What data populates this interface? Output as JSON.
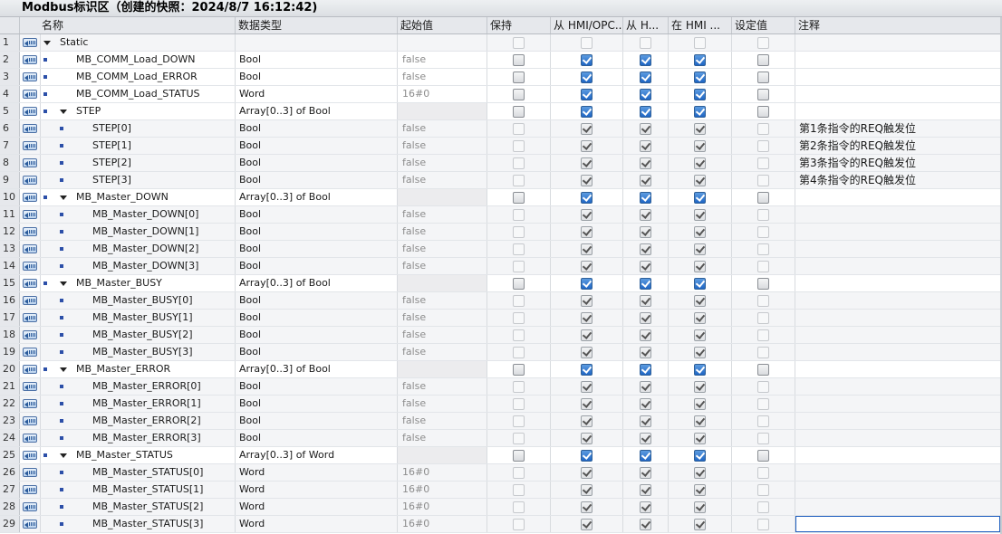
{
  "title": "Modbus标识区（创建的快照：2024/8/7 16:12:42)",
  "columns": {
    "name": "名称",
    "datatype": "数据类型",
    "start": "起始值",
    "retain": "保持",
    "hmi_access": "从 HMI/OPC..",
    "hmi_write": "从 H...",
    "hmi_visible": "在 HMI ...",
    "setpoint": "设定值",
    "comment": "注释"
  },
  "rows": [
    {
      "num": "1",
      "level": 0,
      "marker": "arrow",
      "name": "Static",
      "datatype": "",
      "start": "",
      "flags": [],
      "comment": ""
    },
    {
      "num": "2",
      "level": 1,
      "marker": "none",
      "name": "MB_COMM_Load_DOWN",
      "datatype": "Bool",
      "start": "false",
      "flags": [
        "u",
        "c",
        "c",
        "c",
        "u"
      ],
      "comment": ""
    },
    {
      "num": "3",
      "level": 1,
      "marker": "none",
      "name": "MB_COMM_Load_ERROR",
      "datatype": "Bool",
      "start": "false",
      "flags": [
        "u",
        "c",
        "c",
        "c",
        "u"
      ],
      "comment": ""
    },
    {
      "num": "4",
      "level": 1,
      "marker": "none",
      "name": "MB_COMM_Load_STATUS",
      "datatype": "Word",
      "start": "16#0",
      "flags": [
        "u",
        "c",
        "c",
        "c",
        "u"
      ],
      "comment": ""
    },
    {
      "num": "5",
      "level": 1,
      "marker": "arrow",
      "name": "STEP",
      "datatype": "Array[0..3] of Bool",
      "start": "",
      "flags": [
        "u",
        "c",
        "c",
        "c",
        "u"
      ],
      "comment": ""
    },
    {
      "num": "6",
      "level": 2,
      "marker": "none",
      "name": "STEP[0]",
      "datatype": "Bool",
      "start": "false",
      "flags": [
        "d",
        "g",
        "g",
        "g",
        "d"
      ],
      "comment": "第1条指令的REQ触发位"
    },
    {
      "num": "7",
      "level": 2,
      "marker": "none",
      "name": "STEP[1]",
      "datatype": "Bool",
      "start": "false",
      "flags": [
        "d",
        "g",
        "g",
        "g",
        "d"
      ],
      "comment": "第2条指令的REQ触发位"
    },
    {
      "num": "8",
      "level": 2,
      "marker": "none",
      "name": "STEP[2]",
      "datatype": "Bool",
      "start": "false",
      "flags": [
        "d",
        "g",
        "g",
        "g",
        "d"
      ],
      "comment": "第3条指令的REQ触发位"
    },
    {
      "num": "9",
      "level": 2,
      "marker": "none",
      "name": "STEP[3]",
      "datatype": "Bool",
      "start": "false",
      "flags": [
        "d",
        "g",
        "g",
        "g",
        "d"
      ],
      "comment": "第4条指令的REQ触发位"
    },
    {
      "num": "10",
      "level": 1,
      "marker": "arrow",
      "name": "MB_Master_DOWN",
      "datatype": "Array[0..3] of Bool",
      "start": "",
      "flags": [
        "u",
        "c",
        "c",
        "c",
        "u"
      ],
      "comment": ""
    },
    {
      "num": "11",
      "level": 2,
      "marker": "none",
      "name": "MB_Master_DOWN[0]",
      "datatype": "Bool",
      "start": "false",
      "flags": [
        "d",
        "g",
        "g",
        "g",
        "d"
      ],
      "comment": ""
    },
    {
      "num": "12",
      "level": 2,
      "marker": "none",
      "name": "MB_Master_DOWN[1]",
      "datatype": "Bool",
      "start": "false",
      "flags": [
        "d",
        "g",
        "g",
        "g",
        "d"
      ],
      "comment": ""
    },
    {
      "num": "13",
      "level": 2,
      "marker": "none",
      "name": "MB_Master_DOWN[2]",
      "datatype": "Bool",
      "start": "false",
      "flags": [
        "d",
        "g",
        "g",
        "g",
        "d"
      ],
      "comment": ""
    },
    {
      "num": "14",
      "level": 2,
      "marker": "none",
      "name": "MB_Master_DOWN[3]",
      "datatype": "Bool",
      "start": "false",
      "flags": [
        "d",
        "g",
        "g",
        "g",
        "d"
      ],
      "comment": ""
    },
    {
      "num": "15",
      "level": 1,
      "marker": "arrow",
      "name": "MB_Master_BUSY",
      "datatype": "Array[0..3] of Bool",
      "start": "",
      "flags": [
        "u",
        "c",
        "c",
        "c",
        "u"
      ],
      "comment": ""
    },
    {
      "num": "16",
      "level": 2,
      "marker": "none",
      "name": "MB_Master_BUSY[0]",
      "datatype": "Bool",
      "start": "false",
      "flags": [
        "d",
        "g",
        "g",
        "g",
        "d"
      ],
      "comment": ""
    },
    {
      "num": "17",
      "level": 2,
      "marker": "none",
      "name": "MB_Master_BUSY[1]",
      "datatype": "Bool",
      "start": "false",
      "flags": [
        "d",
        "g",
        "g",
        "g",
        "d"
      ],
      "comment": ""
    },
    {
      "num": "18",
      "level": 2,
      "marker": "none",
      "name": "MB_Master_BUSY[2]",
      "datatype": "Bool",
      "start": "false",
      "flags": [
        "d",
        "g",
        "g",
        "g",
        "d"
      ],
      "comment": ""
    },
    {
      "num": "19",
      "level": 2,
      "marker": "none",
      "name": "MB_Master_BUSY[3]",
      "datatype": "Bool",
      "start": "false",
      "flags": [
        "d",
        "g",
        "g",
        "g",
        "d"
      ],
      "comment": ""
    },
    {
      "num": "20",
      "level": 1,
      "marker": "arrow",
      "name": "MB_Master_ERROR",
      "datatype": "Array[0..3] of Bool",
      "start": "",
      "flags": [
        "u",
        "c",
        "c",
        "c",
        "u"
      ],
      "comment": ""
    },
    {
      "num": "21",
      "level": 2,
      "marker": "none",
      "name": "MB_Master_ERROR[0]",
      "datatype": "Bool",
      "start": "false",
      "flags": [
        "d",
        "g",
        "g",
        "g",
        "d"
      ],
      "comment": ""
    },
    {
      "num": "22",
      "level": 2,
      "marker": "none",
      "name": "MB_Master_ERROR[1]",
      "datatype": "Bool",
      "start": "false",
      "flags": [
        "d",
        "g",
        "g",
        "g",
        "d"
      ],
      "comment": ""
    },
    {
      "num": "23",
      "level": 2,
      "marker": "none",
      "name": "MB_Master_ERROR[2]",
      "datatype": "Bool",
      "start": "false",
      "flags": [
        "d",
        "g",
        "g",
        "g",
        "d"
      ],
      "comment": ""
    },
    {
      "num": "24",
      "level": 2,
      "marker": "none",
      "name": "MB_Master_ERROR[3]",
      "datatype": "Bool",
      "start": "false",
      "flags": [
        "d",
        "g",
        "g",
        "g",
        "d"
      ],
      "comment": ""
    },
    {
      "num": "25",
      "level": 1,
      "marker": "arrow",
      "name": "MB_Master_STATUS",
      "datatype": "Array[0..3] of Word",
      "start": "",
      "flags": [
        "u",
        "c",
        "c",
        "c",
        "u"
      ],
      "comment": ""
    },
    {
      "num": "26",
      "level": 2,
      "marker": "none",
      "name": "MB_Master_STATUS[0]",
      "datatype": "Word",
      "start": "16#0",
      "flags": [
        "d",
        "g",
        "g",
        "g",
        "d"
      ],
      "comment": ""
    },
    {
      "num": "27",
      "level": 2,
      "marker": "none",
      "name": "MB_Master_STATUS[1]",
      "datatype": "Word",
      "start": "16#0",
      "flags": [
        "d",
        "g",
        "g",
        "g",
        "d"
      ],
      "comment": ""
    },
    {
      "num": "28",
      "level": 2,
      "marker": "none",
      "name": "MB_Master_STATUS[2]",
      "datatype": "Word",
      "start": "16#0",
      "flags": [
        "d",
        "g",
        "g",
        "g",
        "d"
      ],
      "comment": ""
    },
    {
      "num": "29",
      "level": 2,
      "marker": "none",
      "name": "MB_Master_STATUS[3]",
      "datatype": "Word",
      "start": "16#0",
      "flags": [
        "d",
        "g",
        "g",
        "g",
        "d"
      ],
      "comment": ""
    }
  ],
  "icons": {
    "row_icon": "db-tag-icon",
    "member_marker": "member-bullet-icon",
    "expand": "expand-arrow-icon"
  },
  "colors": {
    "checked_accent": "#1f66c4",
    "header_bg": "#e6e8ec",
    "edit_border": "#1f5fbf"
  }
}
